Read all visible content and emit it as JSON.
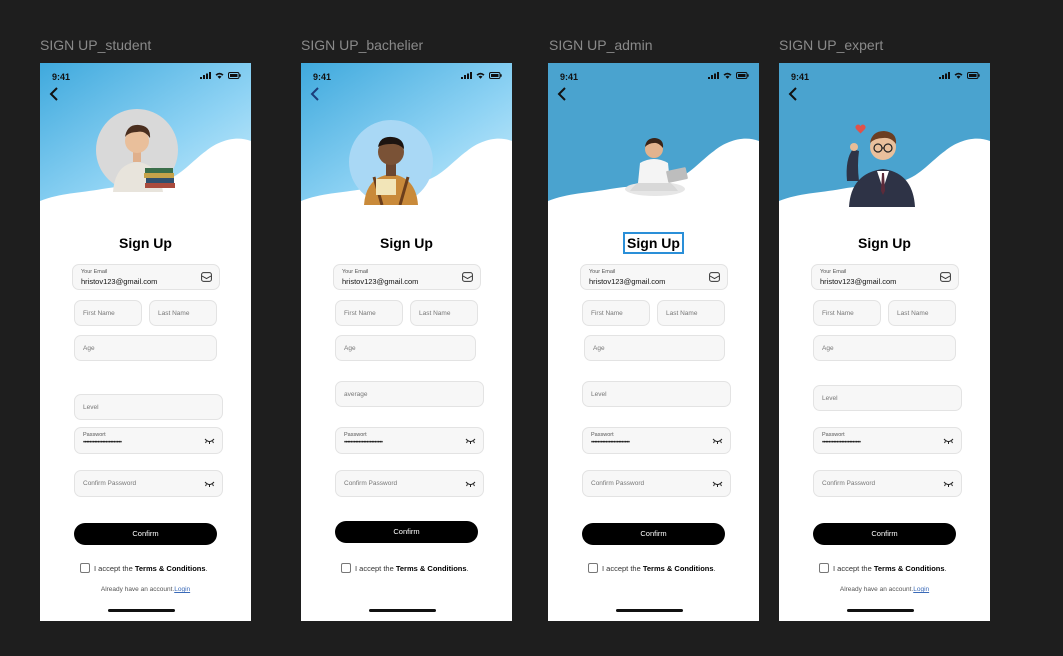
{
  "frames": [
    {
      "title": "SIGN UP_student",
      "time": "9:41",
      "heading": "Sign Up",
      "email_label": "Your Email",
      "email_value": "hristov123@gmail.com",
      "first_name_placeholder": "First Name",
      "last_name_placeholder": "Last Name",
      "age_placeholder": "Age",
      "level_text": "Level",
      "password_label": "Passwort",
      "password_value": "••••••••••••••••••••••••",
      "confirm_password_placeholder": "Confirm Password",
      "confirm_label": "Confirm",
      "terms_prefix": "I accept the ",
      "terms_link": "Terms & Conditions",
      "terms_suffix": ".",
      "login_prefix": "Already have an account.",
      "login_link": "Login"
    },
    {
      "title": "SIGN UP_bachelier",
      "time": "9:41",
      "heading": "Sign Up",
      "email_label": "Your Email",
      "email_value": "hristov123@gmail.com",
      "first_name_placeholder": "First Name",
      "last_name_placeholder": "Last Name",
      "age_placeholder": "Age",
      "level_text": "average",
      "password_label": "Passwort",
      "password_value": "••••••••••••••••••••••••",
      "confirm_password_placeholder": "Confirm Password",
      "confirm_label": "Confirm",
      "terms_prefix": "I accept the ",
      "terms_link": "Terms & Conditions",
      "terms_suffix": "."
    },
    {
      "title": "SIGN UP_admin",
      "time": "9:41",
      "heading": "Sign Up",
      "email_label": "Your Email",
      "email_value": "hristov123@gmail.com",
      "first_name_placeholder": "First Name",
      "last_name_placeholder": "Last Name",
      "age_placeholder": "Age",
      "level_text": "Level",
      "password_label": "Passwort",
      "password_value": "••••••••••••••••••••••••",
      "confirm_password_placeholder": "Confirm Password",
      "confirm_label": "Confirm",
      "terms_prefix": "I accept the ",
      "terms_link": "Terms & Conditions",
      "terms_suffix": "."
    },
    {
      "title": "SIGN UP_expert",
      "time": "9:41",
      "heading": "Sign Up",
      "email_label": "Your Email",
      "email_value": "hristov123@gmail.com",
      "first_name_placeholder": "First Name",
      "last_name_placeholder": "Last Name",
      "age_placeholder": "Age",
      "level_text": "Level",
      "password_label": "Passwort",
      "password_value": "••••••••••••••••••••••••",
      "confirm_password_placeholder": "Confirm Password",
      "confirm_label": "Confirm",
      "terms_prefix": "I accept the ",
      "terms_link": "Terms & Conditions",
      "terms_suffix": ".",
      "login_prefix": "Already have an account.",
      "login_link": "Login"
    }
  ],
  "colors": {
    "canvas": "#1e1e1e",
    "hero_light_blue": "#8fd3f4",
    "hero_blue": "#41aade",
    "hero_flat_blue": "#4aa3cf",
    "selection": "#2a8fd8",
    "button": "#000000"
  },
  "icons": [
    "chevron-left-icon",
    "mail-icon",
    "eye-closed-icon",
    "signal-icon",
    "wifi-icon",
    "battery-icon",
    "heart-icon"
  ]
}
